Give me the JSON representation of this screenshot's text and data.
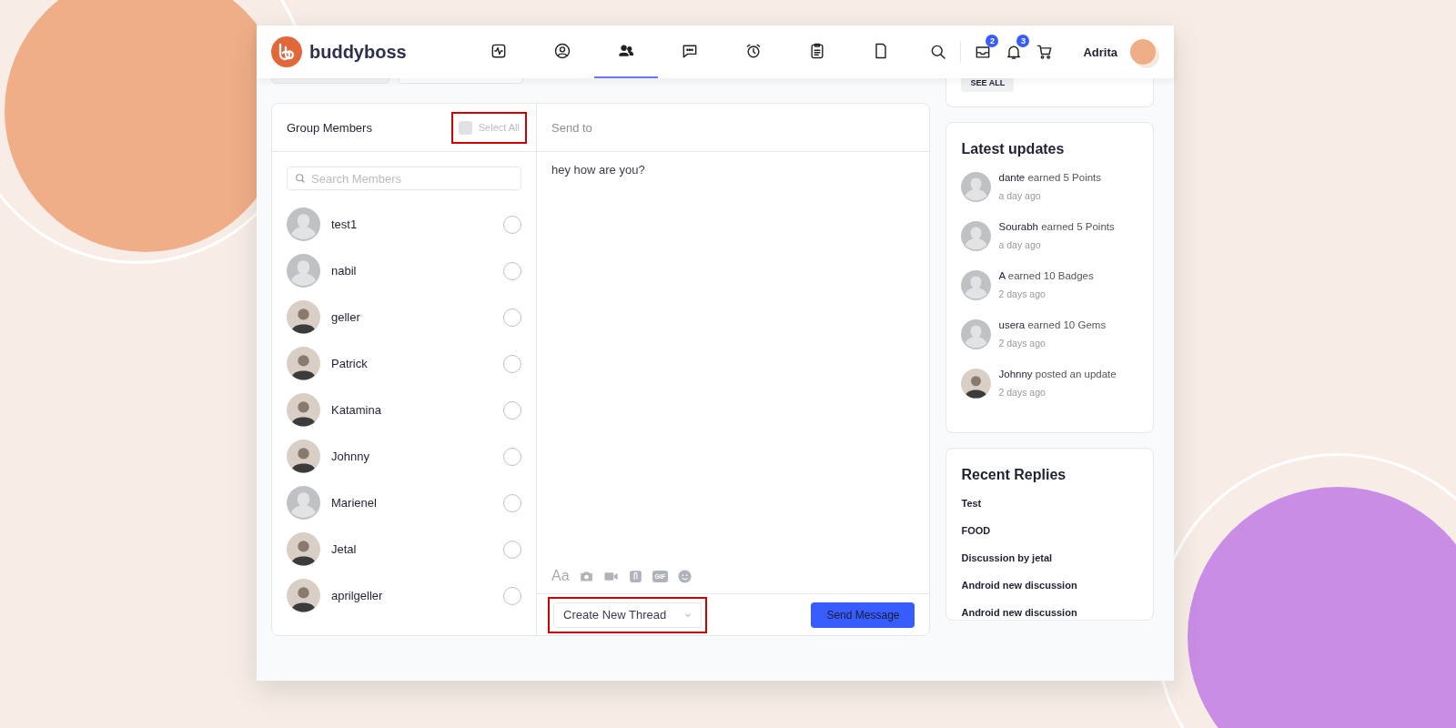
{
  "header": {
    "brand": "buddyboss",
    "nav": [
      {
        "selected": false
      },
      {
        "selected": false
      },
      {
        "selected": true
      },
      {
        "selected": false
      },
      {
        "selected": false
      },
      {
        "selected": false
      },
      {
        "selected": false
      }
    ],
    "inbox_badge": "2",
    "notifications_badge": "3",
    "user_name": "Adrita"
  },
  "top_card": {
    "button": "SEE ALL"
  },
  "members_panel": {
    "title": "Group Members",
    "select_all": {
      "label": "Select All",
      "checked": false,
      "highlighted": true
    },
    "search": {
      "placeholder": "Search Members"
    },
    "members": [
      {
        "name": "test1",
        "photo": false,
        "checked": false
      },
      {
        "name": "nabil",
        "photo": false,
        "checked": false
      },
      {
        "name": "geller",
        "photo": true,
        "checked": false
      },
      {
        "name": "Patrick",
        "photo": true,
        "checked": false
      },
      {
        "name": "Katamina",
        "photo": true,
        "checked": false
      },
      {
        "name": "Johnny",
        "photo": true,
        "checked": false
      },
      {
        "name": "Marienel",
        "photo": false,
        "checked": false
      },
      {
        "name": "Jetal",
        "photo": true,
        "checked": false
      },
      {
        "name": "aprilgeller",
        "photo": true,
        "checked": false
      }
    ]
  },
  "compose": {
    "to_placeholder": "Send to",
    "message": "hey how are you?",
    "format_label": "Aa",
    "gif_label": "GIF",
    "thread_select": {
      "value": "Create New Thread",
      "highlighted": true
    },
    "send_button": "Send Message"
  },
  "latest_updates": {
    "title": "Latest updates",
    "items": [
      {
        "actor": "dante",
        "action": "earned 5 Points",
        "time": "a day ago",
        "photo": false
      },
      {
        "actor": "Sourabh",
        "action": "earned 5 Points",
        "time": "a day ago",
        "photo": false
      },
      {
        "actor": "A",
        "action": "earned 10 Badges",
        "time": "2 days ago",
        "photo": false
      },
      {
        "actor": "usera",
        "action": "earned 10 Gems",
        "time": "2 days ago",
        "photo": false
      },
      {
        "actor": "Johnny",
        "action": "posted an update",
        "time": "2 days ago",
        "photo": true
      }
    ]
  },
  "recent_replies": {
    "title": "Recent Replies",
    "items": [
      "Test",
      "FOOD",
      "Discussion by jetal",
      "Android new discussion",
      "Android new discussion"
    ]
  }
}
